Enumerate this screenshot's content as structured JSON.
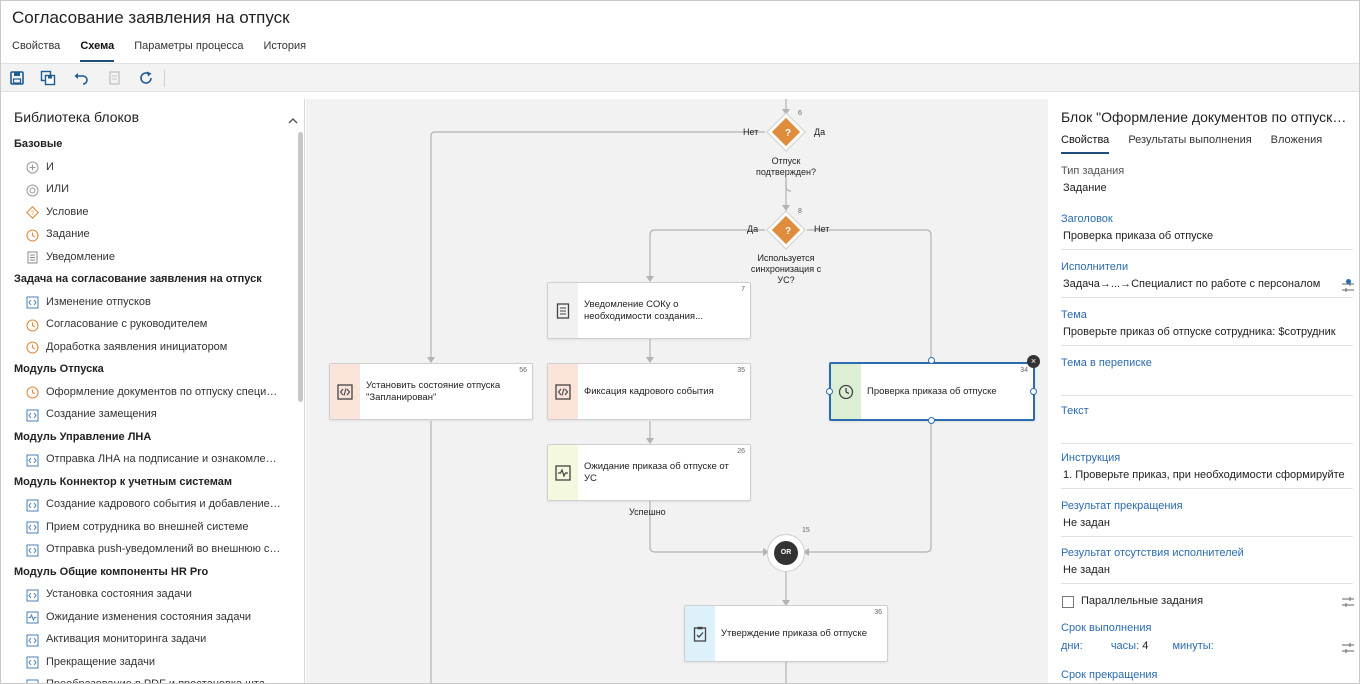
{
  "header": {
    "title": "Согласование заявления на отпуск",
    "tabs": [
      "Свойства",
      "Схема",
      "Параметры процесса",
      "История"
    ],
    "active_tab": "Схема"
  },
  "toolbar": {
    "buttons": [
      "save-icon",
      "save-as-icon",
      "undo-icon",
      "copy-icon",
      "refresh-icon"
    ]
  },
  "library": {
    "title": "Библиотека блоков",
    "groups": [
      {
        "name": "Базовые",
        "items": [
          {
            "label": "И",
            "icon": "and-icon"
          },
          {
            "label": "ИЛИ",
            "icon": "or-icon"
          },
          {
            "label": "Условие",
            "icon": "condition-icon"
          },
          {
            "label": "Задание",
            "icon": "clock-icon"
          },
          {
            "label": "Уведомление",
            "icon": "notice-icon"
          }
        ]
      },
      {
        "name": "Задача на согласование заявления на отпуск",
        "items": [
          {
            "label": "Изменение отпусков",
            "icon": "code-icon"
          },
          {
            "label": "Согласование с руководителем",
            "icon": "clock-icon"
          },
          {
            "label": "Доработка заявления инициатором",
            "icon": "clock-icon"
          }
        ]
      },
      {
        "name": "Модуль Отпуска",
        "items": [
          {
            "label": "Оформление документов по отпуску специалистом",
            "icon": "clock-icon"
          },
          {
            "label": "Создание замещения",
            "icon": "code-icon"
          }
        ]
      },
      {
        "name": "Модуль Управление ЛНА",
        "items": [
          {
            "label": "Отправка ЛНА на подписание и ознакомление",
            "icon": "code-icon"
          }
        ]
      },
      {
        "name": "Модуль Коннектор к учетным системам",
        "items": [
          {
            "label": "Создание кадрового события и добавление в очередь",
            "icon": "code-icon"
          },
          {
            "label": "Прием сотрудника во внешней системе",
            "icon": "code-icon"
          },
          {
            "label": "Отправка push-уведомлений во внешнюю систему",
            "icon": "code-icon"
          }
        ]
      },
      {
        "name": "Модуль Общие компоненты HR Pro",
        "items": [
          {
            "label": "Установка состояния задачи",
            "icon": "code-icon"
          },
          {
            "label": "Ожидание изменения состояния задачи",
            "icon": "wave-icon"
          },
          {
            "label": "Активация мониторинга задачи",
            "icon": "code-icon"
          },
          {
            "label": "Прекращение задачи",
            "icon": "code-icon"
          },
          {
            "label": "Преобразование в PDF и простановка штампа",
            "icon": "code-icon"
          }
        ]
      }
    ]
  },
  "canvas": {
    "cond6": {
      "num": "6",
      "label1": "Отпуск",
      "label2": "подтвержден?",
      "no": "Нет",
      "yes": "Да",
      "glyph": "?"
    },
    "cond8": {
      "num": "8",
      "label1": "Используется",
      "label2": "синхронизация с",
      "label3": "УС?",
      "yes": "Да",
      "no": "Нет",
      "glyph": "?"
    },
    "node7": {
      "num": "7",
      "text": "Уведомление СОКу о необходимости создания..."
    },
    "node56": {
      "num": "56",
      "text": "Установить состояние отпуска \"Запланирован\""
    },
    "node35": {
      "num": "35",
      "text": "Фиксация кадрового события"
    },
    "node34": {
      "num": "34",
      "text": "Проверка приказа об отпуске"
    },
    "node26": {
      "num": "26",
      "text": "Ожидание приказа об отпуске от УС",
      "edge": "Успешно"
    },
    "or15": {
      "num": "15",
      "text": "OR"
    },
    "node36": {
      "num": "36",
      "text": "Утверждение приказа об отпуске"
    }
  },
  "props": {
    "title": "Блок \"Оформление документов по отпуску специалистом\"",
    "tabs": [
      "Свойства",
      "Результаты выполнения",
      "Вложения"
    ],
    "active_tab": "Свойства",
    "task_type_label": "Тип задания",
    "task_type": "Задание",
    "header_label": "Заголовок",
    "header_value": "Проверка приказа об отпуске",
    "executors_label": "Исполнители",
    "executors_value": "Задача→...→Специалист по работе с персоналом",
    "subject_label": "Тема",
    "subject_value": "Проверьте приказ об отпуске сотрудника: $сотрудник",
    "subject_corr_label": "Тема в переписке",
    "text_label": "Текст",
    "instruction_label": "Инструкция",
    "instruction_value": "1. Проверьте приказ, при необходимости сформируйте",
    "stop_result_label": "Результат прекращения",
    "stop_result_value": "Не задан",
    "no_exec_label": "Результат отсутствия исполнителей",
    "no_exec_value": "Не задан",
    "parallel_label": "Параллельные задания",
    "deadline_label": "Срок выполнения",
    "days_label": "дни:",
    "hours_label": "часы:",
    "hours_value": "4",
    "minutes_label": "минуты:",
    "stop_deadline_label": "Срок прекращения"
  }
}
